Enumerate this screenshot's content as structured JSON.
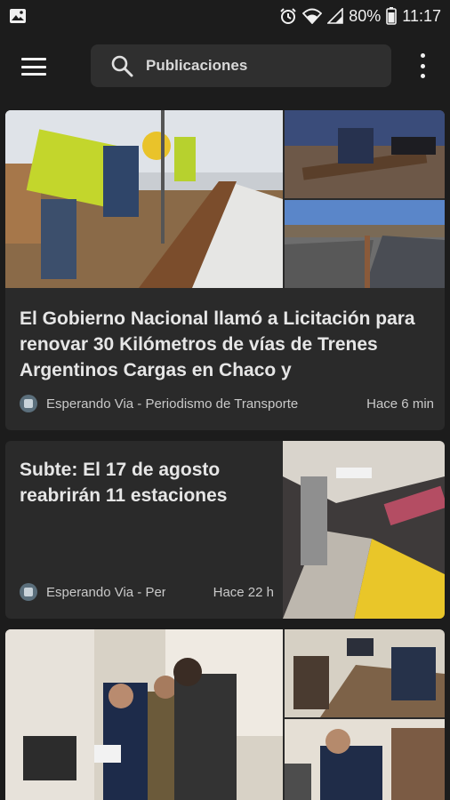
{
  "status_bar": {
    "battery": "80%",
    "time": "11:17",
    "icons": [
      "image-notification-icon",
      "alarm-icon",
      "wifi-icon",
      "signal-icon",
      "battery-icon"
    ]
  },
  "app_bar": {
    "search_label": "Publicaciones",
    "icons": [
      "menu-icon",
      "search-icon",
      "more-vert-icon"
    ]
  },
  "articles": [
    {
      "title": "El Gobierno Nacional llamó a Licitación para renovar 30 Kilómetros de vías de Trenes Argentinos Cargas en Chaco y",
      "source": "Esperando Via - Periodismo de Transporte",
      "time_ago": "Hace 6 min"
    },
    {
      "title": "Subte: El 17 de agosto reabrirán 11 estaciones",
      "source": "Esperando Via - Periodismo de Transporte",
      "source_display": "Esperando Via - Peri",
      "time_ago": "Hace 22 h"
    },
    {
      "title": "",
      "source": "",
      "time_ago": ""
    }
  ],
  "colors": {
    "background": "#1c1c1c",
    "card": "#2a2a2a",
    "search_field": "#2f2f2f",
    "text_primary": "#e6e6e6",
    "text_secondary": "#c9c9c9"
  }
}
